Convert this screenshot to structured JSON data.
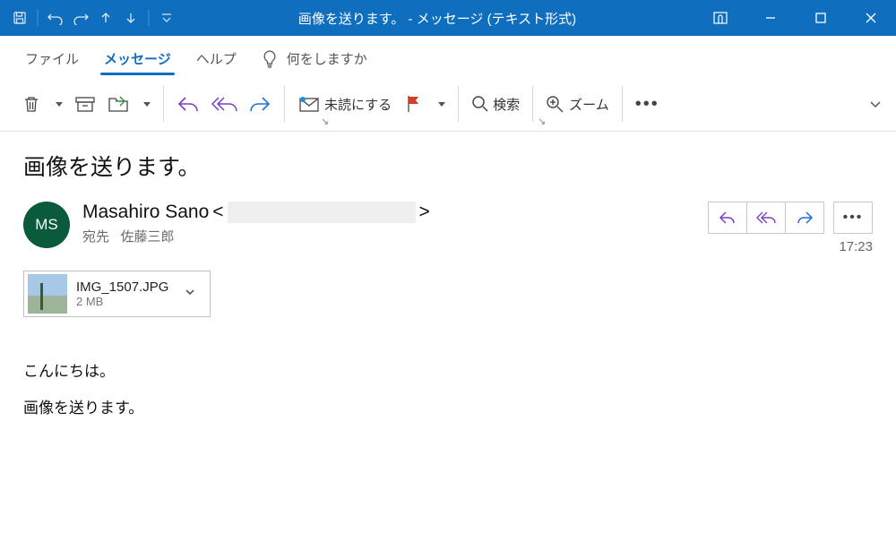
{
  "window": {
    "title": "画像を送ります。  -  メッセージ (テキスト形式)"
  },
  "tabs": {
    "file": "ファイル",
    "message": "メッセージ",
    "help": "ヘルプ",
    "tellme": "何をしますか"
  },
  "ribbon": {
    "unread": "未読にする",
    "search": "検索",
    "zoom": "ズーム"
  },
  "mail": {
    "subject": "画像を送ります。",
    "avatar_initials": "MS",
    "sender_name": "Masahiro Sano",
    "sender_bracket_open": "<",
    "sender_bracket_close": ">",
    "recipient_label": "宛先",
    "recipient_name": "佐藤三郎",
    "time": "17:23",
    "attachment": {
      "filename": "IMG_1507.JPG",
      "size": "2 MB"
    },
    "body_line1": "こんにちは。",
    "body_line2": "画像を送ります。"
  }
}
